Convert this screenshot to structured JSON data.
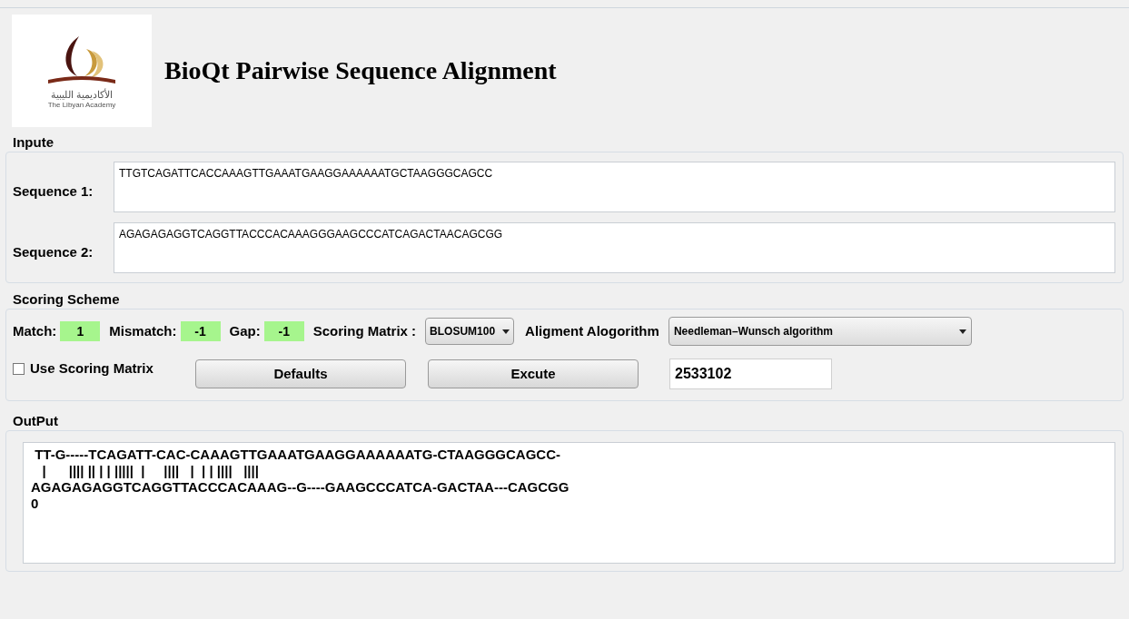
{
  "header": {
    "logo_text": "الأكاديمية الليبية",
    "logo_caption": "The Libyan Academy",
    "title": "BioQt Pairwise Sequence Alignment"
  },
  "input": {
    "title": "Inpute",
    "sequences": [
      {
        "label": "Sequence 1:",
        "value": "TTGTCAGATTCACCAAAGTTGAAATGAAGGAAAAAATGCTAAGGGCAGCC"
      },
      {
        "label": "Sequence 2:",
        "value": "AGAGAGAGGTCAGGTTACCCACAAAGGGAAGCCCATCAGACTAACAGCGG"
      }
    ]
  },
  "scoring": {
    "title": "Scoring Scheme",
    "params": [
      {
        "label": "Match:",
        "value": "1"
      },
      {
        "label": "Mismatch:",
        "value": "-1"
      },
      {
        "label": "Gap:",
        "value": "-1"
      }
    ],
    "matrix_label": "Scoring Matrix :",
    "matrix_value": "BLOSUM100",
    "algorithm_label": "Aligment Alogorithm",
    "algorithm_value": "Needleman–Wunsch algorithm",
    "use_matrix": {
      "label": "Use Scoring Matrix",
      "checked": false
    },
    "buttons": [
      "Defaults",
      "Excute"
    ],
    "result": "2533102"
  },
  "output": {
    "title": "OutPut",
    "lines": [
      " TT-G-----TCAGATT-CAC-CAAAGTTGAAATGAAGGAAAAAATG-CTAAGGGCAGCC-",
      "   |      |||| || | | |||||  |     ||||   |  | | ||||   ||||",
      "AGAGAGAGGTCAGGTTACCCACAAAG--G----GAAGCCCATCA-GACTAA---CAGCGG",
      "0"
    ]
  }
}
